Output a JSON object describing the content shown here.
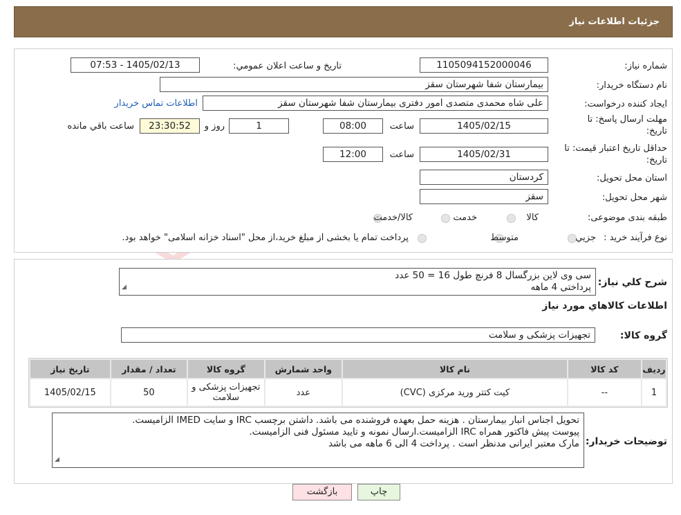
{
  "header": {
    "title": "جزئیات اطلاعات نیاز"
  },
  "fields": {
    "need_number_label": "شماره نیاز:",
    "need_number": "1105094152000046",
    "announce_label": "تاریخ و ساعت اعلان عمومي:",
    "announce_value": "1405/02/13 - 07:53",
    "buyer_org_label": "نام دستگاه خريدار:",
    "buyer_org": "بيمارستان شفا شهرستان سقز",
    "creator_label": "ایجاد کننده درخواست:",
    "creator": "علی شاه محمدی متصدی امور دفتری بیمارستان شفا شهرستان سقز",
    "contact_link": "اطلاعات تماس خريدار",
    "deadline_label": "مهلت ارسال پاسخ: تا",
    "deadline_label2": "تاریخ:",
    "deadline_date": "1405/02/15",
    "time_label": "ساعت",
    "deadline_time": "08:00",
    "days_value": "1",
    "days_label": "روز و",
    "remaining_time": "23:30:52",
    "remaining_label": "ساعت باقي مانده",
    "validity_label": "حداقل تاريخ اعتبار قيمت: تا",
    "validity_label2": "تاریخ:",
    "validity_date": "1405/02/31",
    "validity_time": "12:00",
    "province_label": "استان محل تحويل:",
    "province": "کردستان",
    "city_label": "شهر محل تحويل:",
    "city": "سقز",
    "category_label": "طبقه بندی موضوعی:",
    "category_options": [
      "کالا",
      "خدمت",
      "کالا/خدمت"
    ],
    "process_label": "نوع فرآيند خريد :",
    "process_options": [
      "جزيي",
      "متوسط"
    ],
    "process_note": "پرداخت تمام يا بخشی از مبلغ خريد،از محل \"اسناد خزانه اسلامی\" خواهد بود."
  },
  "description": {
    "label": "شرح کلي نياز:",
    "line1": "سی وی لاین بزرگسال 8 فرنچ طول 16 = 50 عدد",
    "line2": "پرداختی 4 ماهه"
  },
  "goods_section_title": "اطلاعات کالاهاي مورد نياز",
  "goods_group": {
    "label": "گروه کالا:",
    "value": "تجهيزات پزشکی و سلامت"
  },
  "table": {
    "headers": [
      "رديف",
      "کد کالا",
      "نام کالا",
      "واحد شمارش",
      "گروه کالا",
      "تعداد / مقدار",
      "تاریخ نیاز"
    ],
    "rows": [
      [
        "1",
        "--",
        "کیت کتتر ورید مرکزی (CVC)",
        "عدد",
        "تجهيزات پزشکی و سلامت",
        "50",
        "1405/02/15"
      ]
    ]
  },
  "buyer_notes": {
    "label": "توضيحات خريدار:",
    "line1": "تحویل اجناس  انبار بیمارستان . هزینه حمل بعهده فروشنده می باشد.  داشتن برچسب IRC  و سایت  IMED  الزامیست.",
    "line2": "پیوست پیش فاکتور همراه IRC  الزامیست.ارسال نمونه و تایید مسئول فنی الزامیست.",
    "line3": "مارک معتبر ایرانی مدنظر است . پرداخت 4 الی 6 ماهه می باشد"
  },
  "buttons": {
    "print": "چاپ",
    "back": "بازگشت"
  },
  "colors": {
    "header_bg": "#8a6d4b",
    "link": "#1f5fb8",
    "print_btn": "#e7f7df",
    "back_btn": "#fde1e4"
  },
  "watermark": "AriaTender.neT"
}
